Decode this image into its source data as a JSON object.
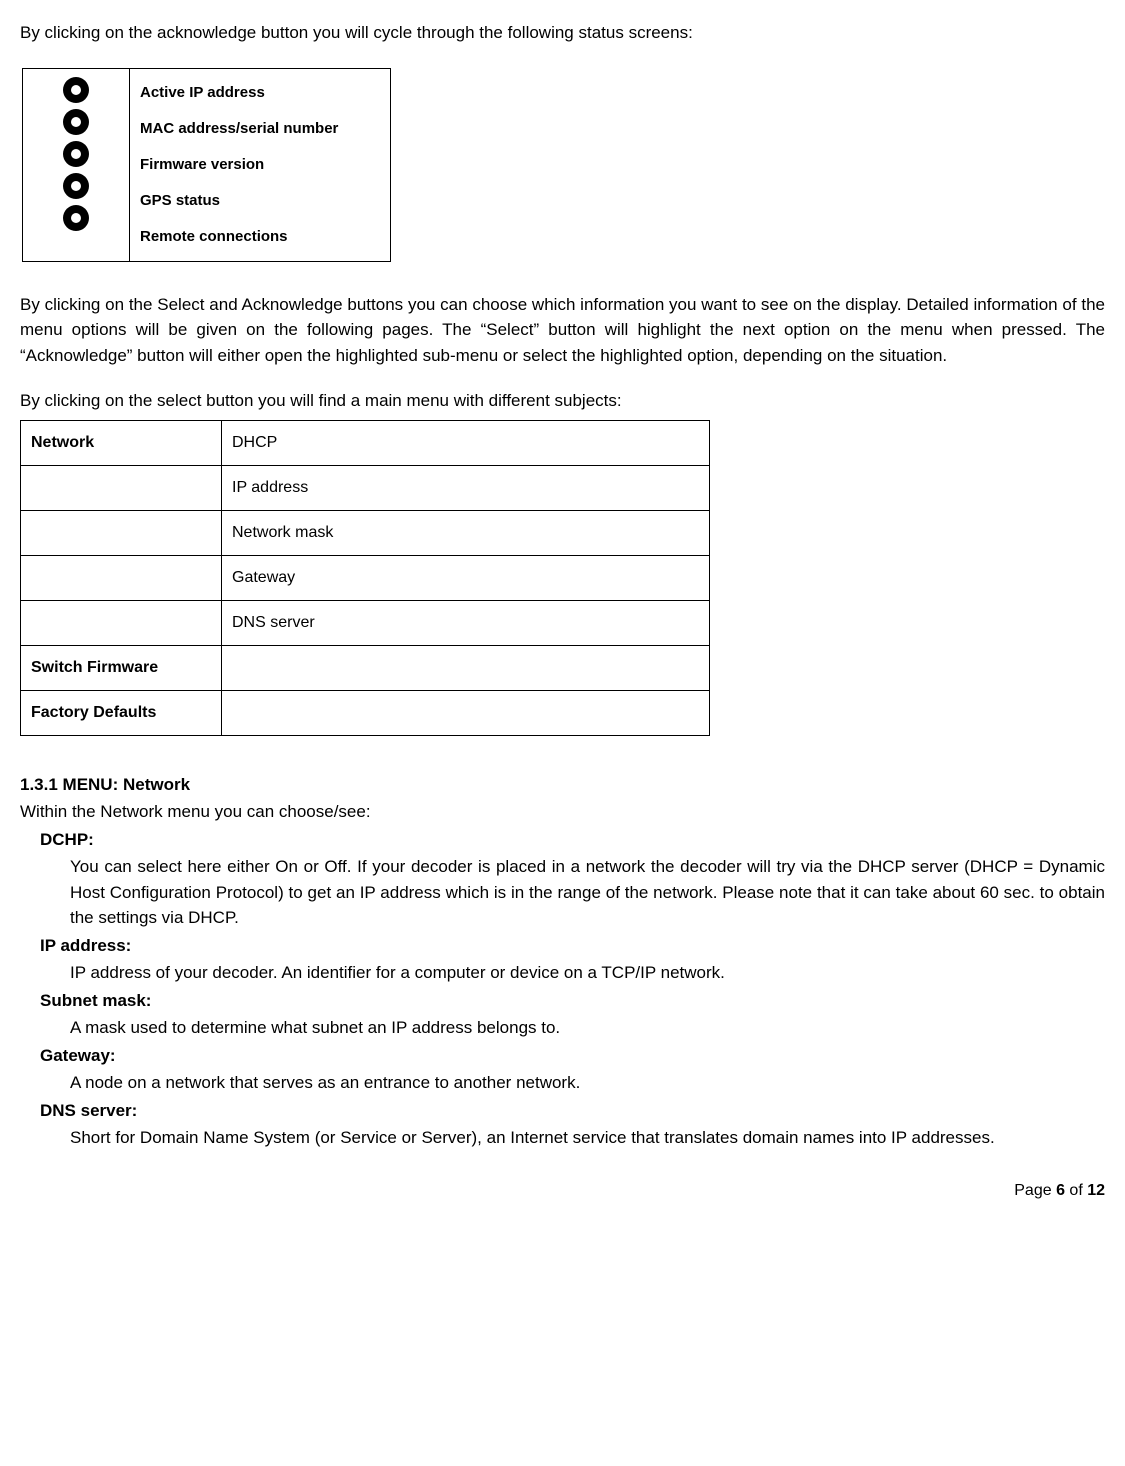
{
  "intro1": "By clicking on the acknowledge button you will cycle through the following status screens:",
  "status_items": {
    "i0": "Active IP address",
    "i1": "MAC address/serial number",
    "i2": "Firmware version",
    "i3": "GPS status",
    "i4": "Remote connections"
  },
  "intro2": "By clicking on the Select and Acknowledge buttons you can choose which information you want to see on the display. Detailed information of the menu options will be given on the following pages. The “Select” button will highlight the next option on the menu when pressed. The “Acknowledge” button will either open the highlighted sub-menu or select the highlighted option, depending on the situation.",
  "intro3": "By clicking on the select button you will find a main menu with different subjects:",
  "menu": {
    "r0a": "Network",
    "r0b": "DHCP",
    "r1a": "",
    "r1b": "IP address",
    "r2a": "",
    "r2b": "Network mask",
    "r3a": "",
    "r3b": "Gateway",
    "r4a": "",
    "r4b": "DNS server",
    "r5a": "Switch Firmware",
    "r5b": "",
    "r6a": "Factory Defaults",
    "r6b": ""
  },
  "section_num": "1.3.1 MENU: Network",
  "section_intro": "Within the Network menu you can choose/see:",
  "defs": {
    "dhcp_l": "DCHP:",
    "dhcp_t": "You can select here either On or Off. If your decoder is placed in a network the decoder will try via the DHCP server (DHCP = Dynamic Host Configuration Protocol) to get an IP address which is in the range of the network. Please note that it can take about 60 sec. to obtain the settings via DHCP.",
    "ip_l": "IP address:",
    "ip_t": "IP address of your decoder. An identifier for a computer or device on a TCP/IP network.",
    "subnet_l": "Subnet mask:",
    "subnet_t": "A mask used to determine what subnet an IP address belongs to.",
    "gateway_l": "Gateway:",
    "gateway_t": "A node on a network that serves as an entrance to another network.",
    "dns_l": "DNS server:",
    "dns_t": "Short for Domain Name System (or Service or Server), an Internet service that translates domain names into IP addresses."
  },
  "footer": {
    "pre": "Page ",
    "cur": "6",
    "mid": " of ",
    "total": "12"
  }
}
